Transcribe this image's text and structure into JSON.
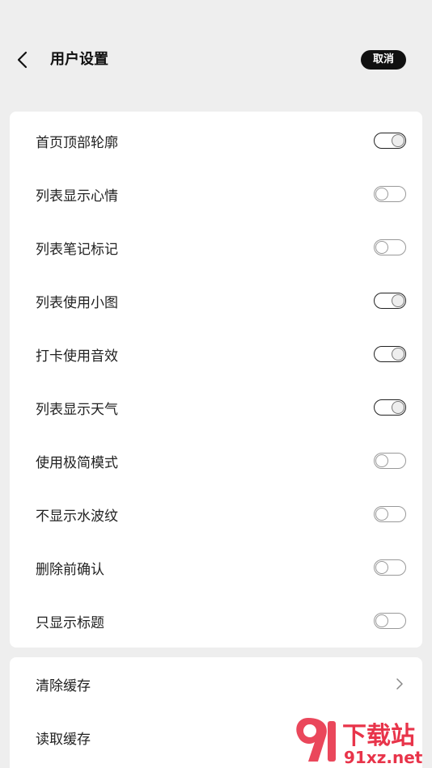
{
  "header": {
    "title": "用户设置",
    "cancel_label": "取消"
  },
  "toggles": [
    {
      "label": "首页顶部轮廓",
      "on": true
    },
    {
      "label": "列表显示心情",
      "on": false
    },
    {
      "label": "列表笔记标记",
      "on": false
    },
    {
      "label": "列表使用小图",
      "on": true
    },
    {
      "label": "打卡使用音效",
      "on": true
    },
    {
      "label": "列表显示天气",
      "on": true
    },
    {
      "label": "使用极简模式",
      "on": false
    },
    {
      "label": "不显示水波纹",
      "on": false
    },
    {
      "label": "删除前确认",
      "on": false
    },
    {
      "label": "只显示标题",
      "on": false
    }
  ],
  "cache": {
    "clear_label": "清除缓存",
    "read_label": "读取缓存"
  },
  "watermark": {
    "text_cn": "下载站",
    "text_en": "91xz.net",
    "logo_text": "91"
  },
  "colors": {
    "background": "#eeeeee",
    "card": "#ffffff",
    "accent_dark": "#111111",
    "watermark_red": "#e8344a"
  }
}
